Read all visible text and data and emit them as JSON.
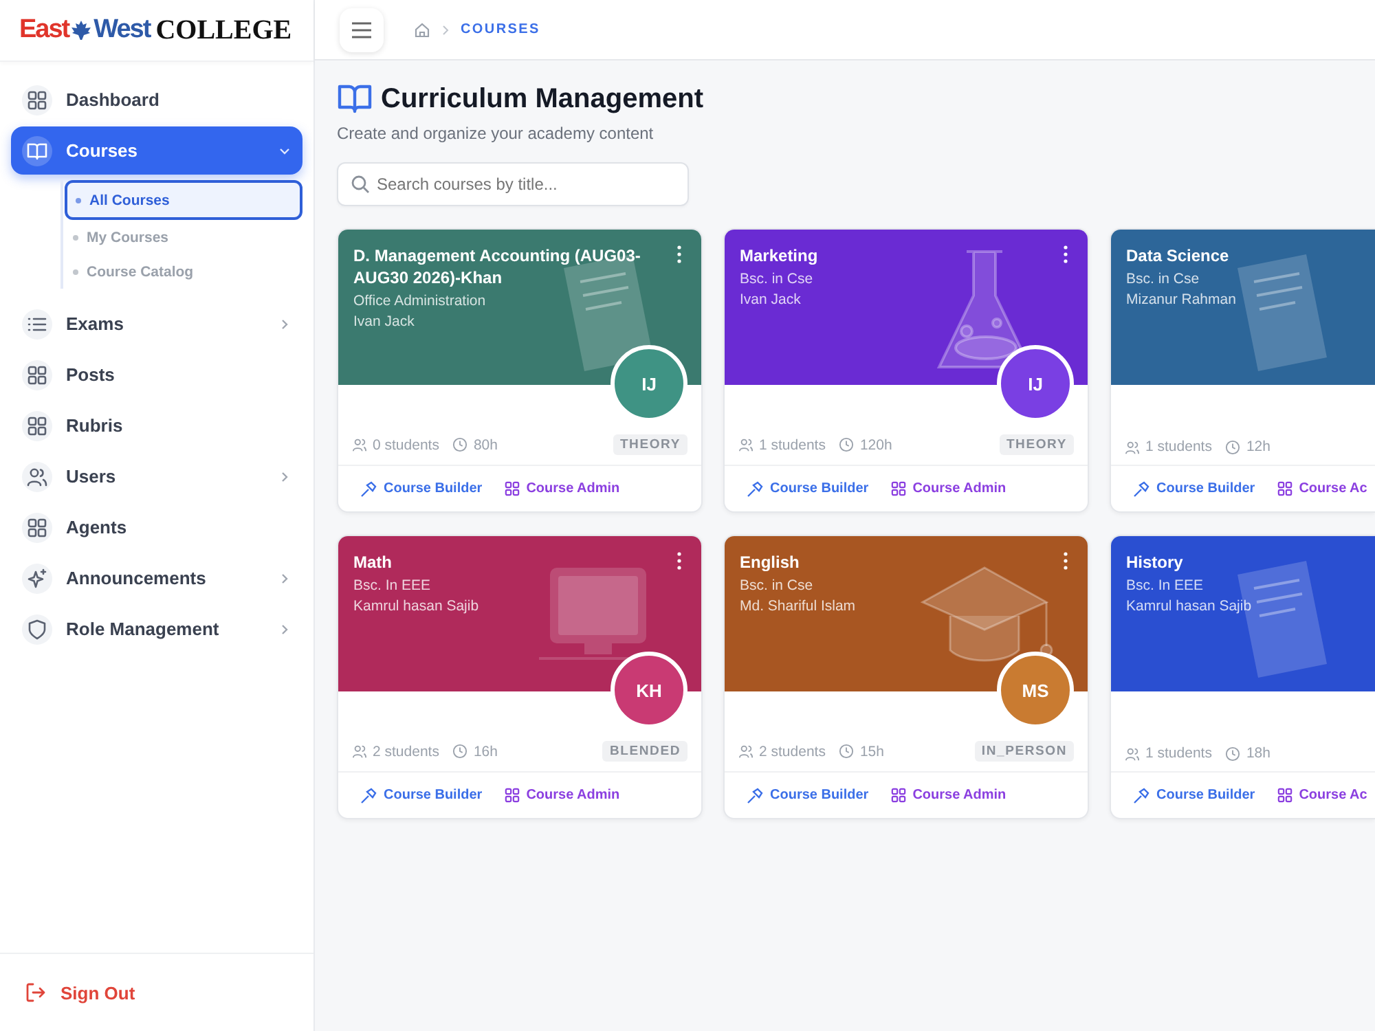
{
  "logo": {
    "part_1": "East",
    "part_2": "West",
    "part_3": "COLLEGE"
  },
  "sidebar": {
    "items": [
      {
        "label": "Dashboard",
        "kind": "grid",
        "selected": false,
        "has_submenu": false
      },
      {
        "label": "Courses",
        "kind": "book",
        "selected": true,
        "has_submenu": true,
        "expanded": true,
        "children": [
          {
            "label": "All Courses",
            "selected": true
          },
          {
            "label": "My Courses",
            "selected": false
          },
          {
            "label": "Course Catalog",
            "selected": false
          }
        ]
      },
      {
        "label": "Exams",
        "kind": "list",
        "selected": false,
        "has_submenu": true,
        "expanded": false
      },
      {
        "label": "Posts",
        "kind": "grid",
        "selected": false,
        "has_submenu": false
      },
      {
        "label": "Rubris",
        "kind": "grid",
        "selected": false,
        "has_submenu": false
      },
      {
        "label": "Users",
        "kind": "users",
        "selected": false,
        "has_submenu": true,
        "expanded": false
      },
      {
        "label": "Agents",
        "kind": "grid",
        "selected": false,
        "has_submenu": false
      },
      {
        "label": "Announcements",
        "kind": "sparkle",
        "selected": false,
        "has_submenu": true,
        "expanded": false
      },
      {
        "label": "Role Management",
        "kind": "shield",
        "selected": false,
        "has_submenu": true,
        "expanded": false
      }
    ],
    "sign_out": "Sign Out"
  },
  "breadcrumb": {
    "current": "COURSES"
  },
  "page": {
    "title": "Curriculum Management",
    "subtitle": "Create and organize your academy content"
  },
  "search": {
    "placeholder": "Search courses by title..."
  },
  "courses": [
    {
      "title": "D. Management Accounting (AUG03-AUG30 2026)-Khan",
      "program": "Office Administration",
      "instructor": "Ivan Jack",
      "color": "#3b7a6f",
      "kind": "document",
      "avatar": {
        "initials": "IJ",
        "color": "#3f9384"
      },
      "students": "0 students",
      "hours": "80h",
      "format": "THEORY",
      "builder": "Course Builder",
      "admin": "Course Admin"
    },
    {
      "title": "Marketing",
      "program": "Bsc. in Cse",
      "instructor": "Ivan Jack",
      "color": "#6a2bd3",
      "kind": "flask",
      "avatar": {
        "initials": "IJ",
        "color": "#7a3fe3"
      },
      "students": "1 students",
      "hours": "120h",
      "format": "THEORY",
      "builder": "Course Builder",
      "admin": "Course Admin"
    },
    {
      "title": "Data Science",
      "program": "Bsc. in Cse",
      "instructor": "Mizanur Rahman",
      "color": "#2d6699",
      "kind": "document",
      "students": "1 students",
      "hours": "12h",
      "builder": "Course Builder",
      "admin": "Course Ac"
    },
    {
      "title": "Math",
      "program": "Bsc. In EEE",
      "instructor": "Kamrul hasan Sajib",
      "color": "#b02a5b",
      "kind": "monitor",
      "avatar": {
        "initials": "KH",
        "color": "#c93a73"
      },
      "students": "2 students",
      "hours": "16h",
      "format": "BLENDED",
      "builder": "Course Builder",
      "admin": "Course Admin"
    },
    {
      "title": "English",
      "program": "Bsc. in Cse",
      "instructor": "Md. Shariful Islam",
      "color": "#a85622",
      "kind": "cap",
      "avatar": {
        "initials": "MS",
        "color": "#c97b31"
      },
      "students": "2 students",
      "hours": "15h",
      "format": "IN_PERSON",
      "builder": "Course Builder",
      "admin": "Course Admin"
    },
    {
      "title": "History",
      "program": "Bsc. In EEE",
      "instructor": "Kamrul hasan Sajib",
      "color": "#2a4fd1",
      "kind": "document",
      "students": "1 students",
      "hours": "18h",
      "builder": "Course Builder",
      "admin": "Course Ac"
    }
  ]
}
